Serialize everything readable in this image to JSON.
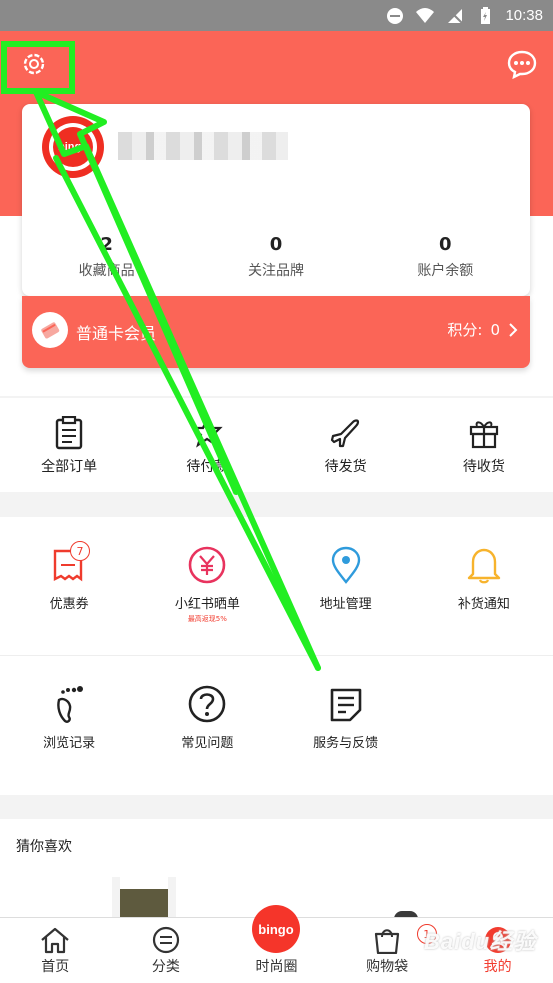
{
  "status_bar": {
    "time": "10:38"
  },
  "profile": {
    "stats": [
      {
        "value": "2",
        "label": "收藏商品"
      },
      {
        "value": "0",
        "label": "关注品牌"
      },
      {
        "value": "0",
        "label": "账户余额"
      }
    ],
    "member_label": "普通卡会员",
    "points_label": "积分:",
    "points_value": "0",
    "avatar_text": "bingo"
  },
  "orders": [
    {
      "label": "全部订单",
      "icon": "clipboard-icon"
    },
    {
      "label": "待付款",
      "icon": "wallet-icon"
    },
    {
      "label": "待发货",
      "icon": "airplane-icon"
    },
    {
      "label": "待收货",
      "icon": "gift-icon"
    }
  ],
  "services": [
    {
      "label": "优惠券",
      "icon": "coupon-icon",
      "badge": "7"
    },
    {
      "label": "小红书晒单",
      "icon": "yen-icon",
      "sub": "最高返现5%"
    },
    {
      "label": "地址管理",
      "icon": "location-pin-icon"
    },
    {
      "label": "补货通知",
      "icon": "bell-icon"
    },
    {
      "label": "浏览记录",
      "icon": "footprint-icon"
    },
    {
      "label": "常见问题",
      "icon": "question-icon"
    },
    {
      "label": "服务与反馈",
      "icon": "feedback-icon"
    }
  ],
  "recommend": {
    "title": "猜你喜欢"
  },
  "bottom_nav": [
    {
      "label": "首页",
      "icon": "home-icon"
    },
    {
      "label": "分类",
      "icon": "category-icon"
    },
    {
      "label": "时尚圈",
      "icon": "bingo-logo-icon",
      "logo_text": "bingo"
    },
    {
      "label": "购物袋",
      "icon": "shopping-bag-icon",
      "badge": "1"
    },
    {
      "label": "我的",
      "icon": "profile-icon"
    }
  ],
  "watermark": "Baidu经验",
  "colors": {
    "brand": "#fb6557",
    "accent": "#f23b2e",
    "annotation": "#22ee22"
  }
}
